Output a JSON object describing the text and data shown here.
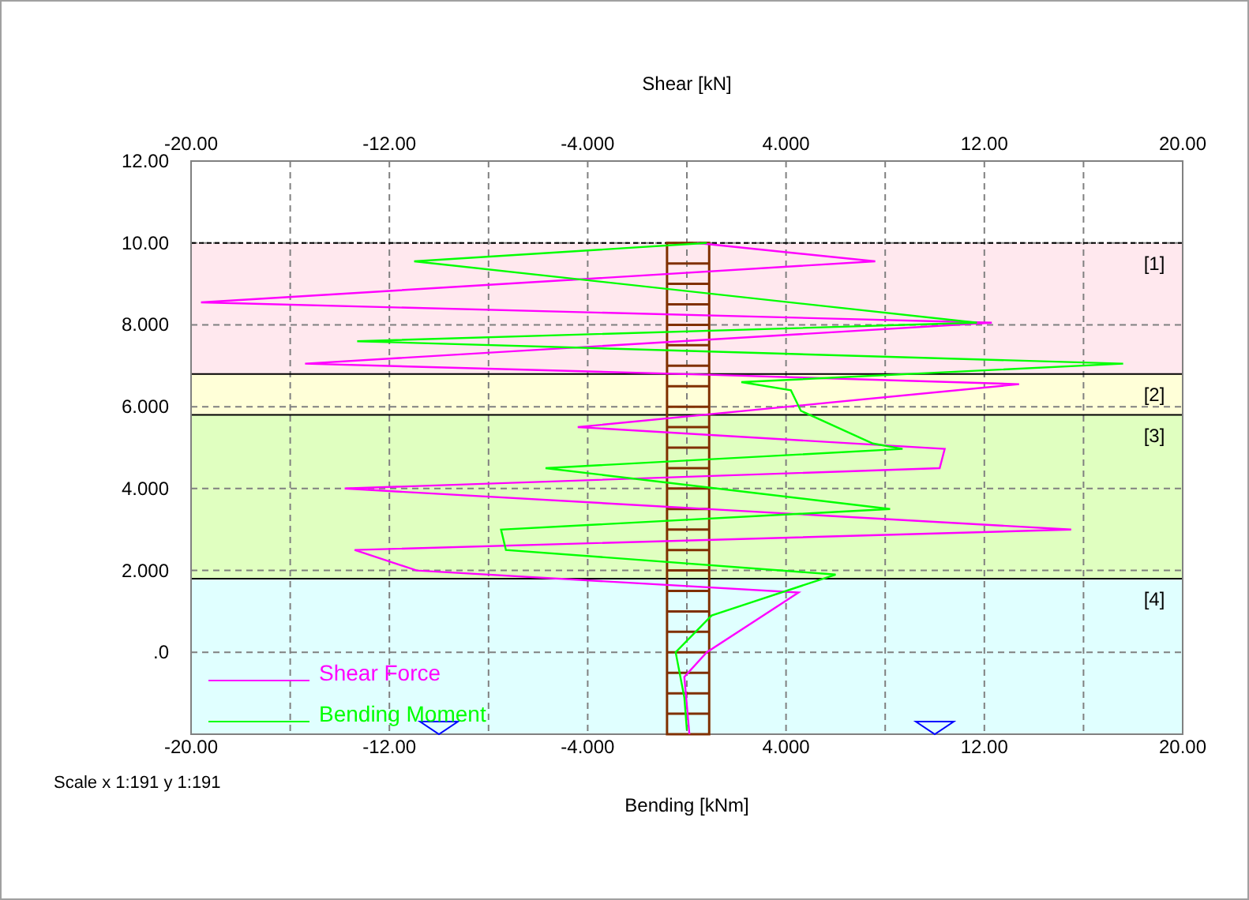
{
  "chart_data": {
    "type": "line",
    "xlabel": "Bending [kNm]",
    "x2label": "Shear [kN]",
    "xlim": [
      -20,
      20
    ],
    "x2lim": [
      -20,
      20
    ],
    "ylim": [
      -2,
      12
    ],
    "xticks": [
      {
        "value": -20,
        "label": "-20.00"
      },
      {
        "value": -12,
        "label": "-12.00"
      },
      {
        "value": -4,
        "label": "-4.000"
      },
      {
        "value": 4,
        "label": "4.000"
      },
      {
        "value": 12,
        "label": "12.00"
      },
      {
        "value": 20,
        "label": "20.00"
      }
    ],
    "x2ticks": [
      {
        "value": -20,
        "label": "-20.00"
      },
      {
        "value": -12,
        "label": "-12.00"
      },
      {
        "value": -4,
        "label": "-4.000"
      },
      {
        "value": 4,
        "label": "4.000"
      },
      {
        "value": 12,
        "label": "12.00"
      },
      {
        "value": 20,
        "label": "20.00"
      }
    ],
    "yticks": [
      {
        "value": 12,
        "label": "12.00"
      },
      {
        "value": 10,
        "label": "10.00"
      },
      {
        "value": 8,
        "label": "8.000"
      },
      {
        "value": 6,
        "label": "6.000"
      },
      {
        "value": 4,
        "label": "4.000"
      },
      {
        "value": 2,
        "label": "2.000"
      },
      {
        "value": 0,
        "label": ".0"
      }
    ],
    "series": [
      {
        "name": "Shear Force",
        "color": "#ff00ff",
        "x": [
          0.4,
          7.6,
          -19.6,
          12.3,
          -15.4,
          0.8,
          13.4,
          -4.4,
          10.4,
          10.2,
          -13.8,
          15.5,
          -13.4,
          -10.9,
          4.5,
          0.8,
          -0.1,
          0.1
        ],
        "values": [
          10.0,
          9.55,
          8.55,
          8.05,
          7.05,
          6.78,
          6.55,
          5.5,
          4.97,
          4.5,
          4.0,
          3.0,
          2.5,
          2.0,
          1.46,
          0.0,
          -0.6,
          -2.0
        ]
      },
      {
        "name": "Bending Moment",
        "color": "#00ff00",
        "x": [
          0.8,
          -11.0,
          11.7,
          -13.3,
          17.6,
          2.2,
          4.2,
          4.6,
          7.5,
          8.7,
          -5.7,
          8.2,
          -7.5,
          -7.3,
          6.0,
          1.0,
          -0.45,
          -0.1,
          0.0
        ],
        "values": [
          10.0,
          9.55,
          8.05,
          7.6,
          7.05,
          6.6,
          6.4,
          5.9,
          5.1,
          4.97,
          4.5,
          3.5,
          3.0,
          2.5,
          1.9,
          0.9,
          0.0,
          -1.1,
          -1.9
        ]
      }
    ],
    "grid": true,
    "legend": true,
    "ref_lines": [
      {
        "axis": "y",
        "value": 10,
        "color": "#000000"
      }
    ],
    "bands": [
      {
        "axis": "y",
        "from": 6.8,
        "to": 10,
        "label": "[1]",
        "color": "#ffe8ee"
      },
      {
        "axis": "y",
        "from": 5.8,
        "to": 6.8,
        "label": "[2]",
        "color": "#ffffd8"
      },
      {
        "axis": "y",
        "from": 1.8,
        "to": 5.8,
        "label": "[3]",
        "color": "#e0ffc0"
      },
      {
        "axis": "y",
        "from": -2,
        "to": 1.8,
        "label": "[4]",
        "color": "#e0ffff"
      }
    ]
  },
  "scale": "Scale x 1:191  y 1:191"
}
